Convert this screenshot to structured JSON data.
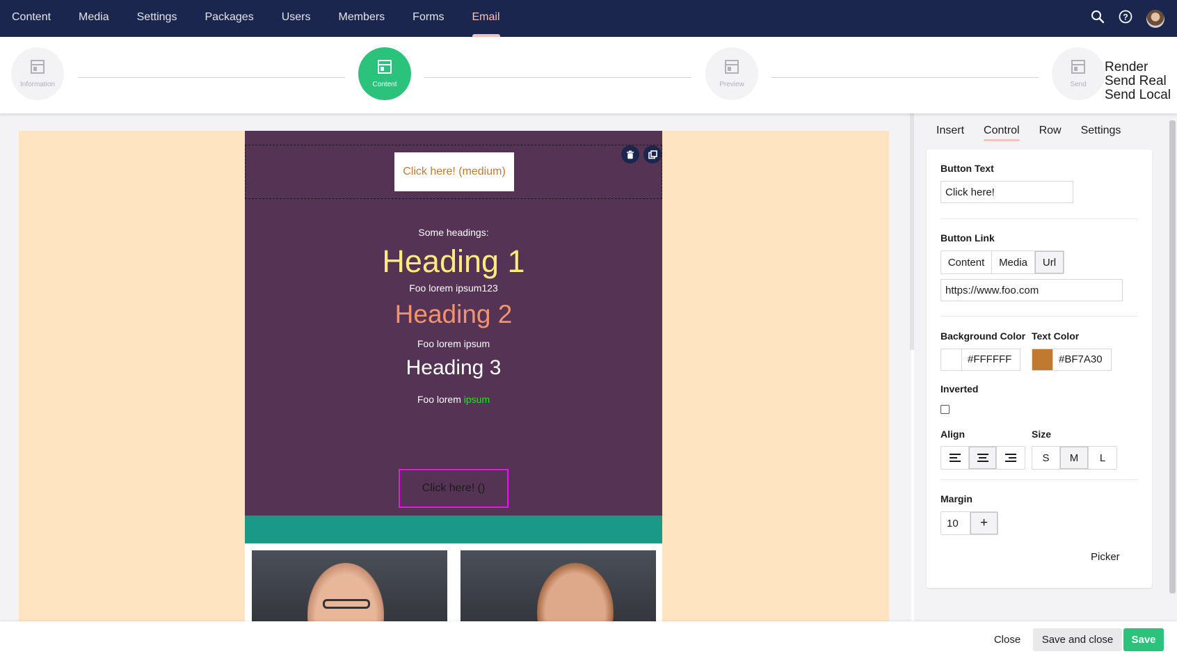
{
  "topnav": {
    "items": [
      "Content",
      "Media",
      "Settings",
      "Packages",
      "Users",
      "Members",
      "Forms",
      "Email"
    ],
    "active": "Email",
    "icons": [
      "search-icon",
      "help-icon",
      "user-avatar"
    ]
  },
  "steps": {
    "items": [
      {
        "label": "Information",
        "active": false
      },
      {
        "label": "Content",
        "active": true
      },
      {
        "label": "Preview",
        "active": false
      },
      {
        "label": "Send",
        "active": false
      }
    ],
    "send_options": [
      "Render",
      "Send Real",
      "Send Local"
    ]
  },
  "email": {
    "button_top": "Click here! (medium)",
    "some_headings": "Some headings:",
    "heading1": "Heading 1",
    "para1": "Foo lorem ipsum123",
    "heading2": "Heading 2",
    "para2": "Foo lorem ipsum",
    "heading3": "Heading 3",
    "para3_prefix": "Foo lorem ",
    "para3_link": "ipsum",
    "button_bottom": "Click here! ()",
    "colors": {
      "page_bg": "#fee4c1",
      "body_bg": "#553355",
      "teal": "#1b9988",
      "heading1": "#ffea7f",
      "heading2": "#f4936b"
    }
  },
  "panel": {
    "tabs": [
      "Insert",
      "Control",
      "Row",
      "Settings"
    ],
    "active_tab": "Control",
    "button_text_label": "Button Text",
    "button_text_value": "Click here!",
    "button_link_label": "Button Link",
    "link_types": [
      "Content",
      "Media",
      "Url"
    ],
    "link_type_selected": "Url",
    "url_value": "https://www.foo.com",
    "bg_color_label": "Background Color",
    "bg_color_value": "#FFFFFF",
    "text_color_label": "Text Color",
    "text_color_value": "#BF7A30",
    "inverted_label": "Inverted",
    "inverted_checked": false,
    "align_label": "Align",
    "align_options": [
      "align-left-icon",
      "align-center-icon",
      "align-right-icon"
    ],
    "align_selected": "center",
    "size_label": "Size",
    "size_options": [
      "S",
      "M",
      "L"
    ],
    "size_selected": "M",
    "margin_label": "Margin",
    "margin_value": "10",
    "margin_add": "+",
    "picker_label": "Picker"
  },
  "footer": {
    "close": "Close",
    "save_and_close": "Save and close",
    "save": "Save"
  }
}
